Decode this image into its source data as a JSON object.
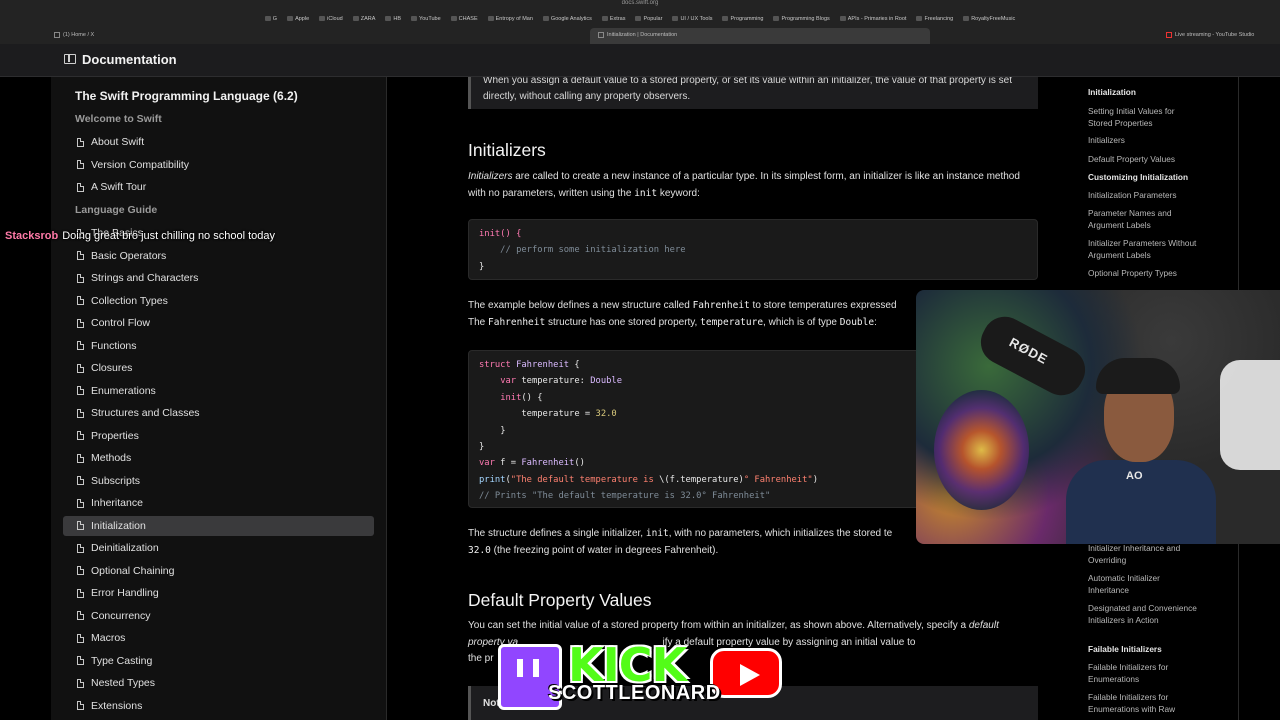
{
  "browser": {
    "url": "docs.swift.org",
    "bookmarks": [
      "G",
      "Apple",
      "iCloud",
      "ZARA",
      "HB",
      "YouTube",
      "CHASE",
      "Entropy of Man",
      "Google Analytics",
      "Extras",
      "Popular",
      "UI / UX Tools",
      "Programming",
      "Programming Blogs",
      "APIs - Primaries in Root",
      "Freelancing",
      "RoyaltyFreeMusic"
    ],
    "tabs": {
      "left": "(1) Home / X",
      "active": "Initialization | Documentation",
      "right": "Live streaming - YouTube Studio"
    }
  },
  "header": {
    "title": "Documentation"
  },
  "sidebar": {
    "book_title": "The Swift Programming Language (6.2)",
    "welcome_section": "Welcome to Swift",
    "welcome_items": [
      "About Swift",
      "Version Compatibility",
      "A Swift Tour"
    ],
    "guide_section": "Language Guide",
    "guide_items": [
      "The Basics",
      "Basic Operators",
      "Strings and Characters",
      "Collection Types",
      "Control Flow",
      "Functions",
      "Closures",
      "Enumerations",
      "Structures and Classes",
      "Properties",
      "Methods",
      "Subscripts",
      "Inheritance",
      "Initialization",
      "Deinitialization",
      "Optional Chaining",
      "Error Handling",
      "Concurrency",
      "Macros",
      "Type Casting",
      "Nested Types",
      "Extensions"
    ],
    "active_item": "Initialization"
  },
  "main": {
    "note_top": "When you assign a default value to a stored property, or set its value within an initializer, the value of that property is set directly, without calling any property observers.",
    "initializers_heading": "Initializers",
    "initializers_para": {
      "term": "Initializers",
      "text1": " are called to create a new instance of a particular type. In its simplest form, an initializer is like an instance method with no parameters, written using the ",
      "code": "init",
      "text2": " keyword:"
    },
    "code1": {
      "line1": "init() {",
      "line2": "    // perform some initialization here",
      "line3": "}"
    },
    "example_para": {
      "t1": "The example below defines a new structure called ",
      "c1": "Fahrenheit",
      "t2": " to store temperatures expressed",
      "t3": "The ",
      "c2": "Fahrenheit",
      "t4": " structure has one stored property, ",
      "c3": "temperature",
      "t5": ", which is of type ",
      "c4": "Double",
      "t6": ":"
    },
    "code2": {
      "l1_kw": "struct",
      "l1_ty": "Fahrenheit",
      "l1_rest": " {",
      "l2_kw": "var",
      "l2_name": " temperature: ",
      "l2_ty": "Double",
      "l3_fn": "init",
      "l3_rest": "() {",
      "l4_name": "temperature = ",
      "l4_num": "32.0",
      "l5": "}",
      "l6": "}",
      "l7_kw": "var",
      "l7_rest": " f = ",
      "l7_ty": "Fahrenheit",
      "l7_end": "()",
      "l8_fn": "print",
      "l8_open": "(",
      "l8_str1": "\"The default temperature is ",
      "l8_interp": "\\(f.temperature)",
      "l8_str2": "° Fahrenheit\"",
      "l8_close": ")",
      "l9": "// Prints \"The default temperature is 32.0° Fahrenheit\""
    },
    "structure_para": {
      "t1": "The structure defines a single initializer, ",
      "c1": "init",
      "t2": ", with no parameters, which initializes the stored te",
      "c2": "32.0",
      "t3": " (the freezing point of water in degrees Fahrenheit)."
    },
    "default_heading": "Default Property Values",
    "default_para": {
      "t1": "You can set the initial value of a stored property from within an initializer, as shown above. Alternatively, specify a ",
      "em1": "default",
      "em2": "property va",
      "t2": "                                                    ify a default property value by assigning an initial value to",
      "t3": "the pr"
    },
    "note_bottom": "Not"
  },
  "toc": {
    "items": [
      {
        "label": "Initialization",
        "bold": true
      },
      {
        "label": "Setting Initial Values for Stored Properties",
        "bold": false
      },
      {
        "label": "Initializers",
        "bold": false
      },
      {
        "label": "Default Property Values",
        "bold": false
      },
      {
        "label": "Customizing Initialization",
        "bold": true
      },
      {
        "label": "Initialization Parameters",
        "bold": false
      },
      {
        "label": "Parameter Names and Argument Labels",
        "bold": false
      },
      {
        "label": "Initializer Parameters Without Argument Labels",
        "bold": false
      },
      {
        "label": "Optional Property Types",
        "bold": false
      },
      {
        "label": "Initializer Inheritance and Overriding",
        "bold": false
      },
      {
        "label": "Automatic Initializer Inheritance",
        "bold": false
      },
      {
        "label": "Designated and Convenience Initializers in Action",
        "bold": false
      },
      {
        "label": "Failable Initializers",
        "bold": true
      },
      {
        "label": "Failable Initializers for Enumerations",
        "bold": false
      },
      {
        "label": "Failable Initializers for Enumerations with Raw",
        "bold": false
      }
    ]
  },
  "overlay": {
    "chat_user": "Stacksrob",
    "chat_msg": "Doing great bro just chilling no school today",
    "webcam_mic_brand": "RØDE",
    "webcam_shirt_mark": "AO",
    "brand_kick": "KICK",
    "brand_name": "SCOTTLEONARD"
  }
}
